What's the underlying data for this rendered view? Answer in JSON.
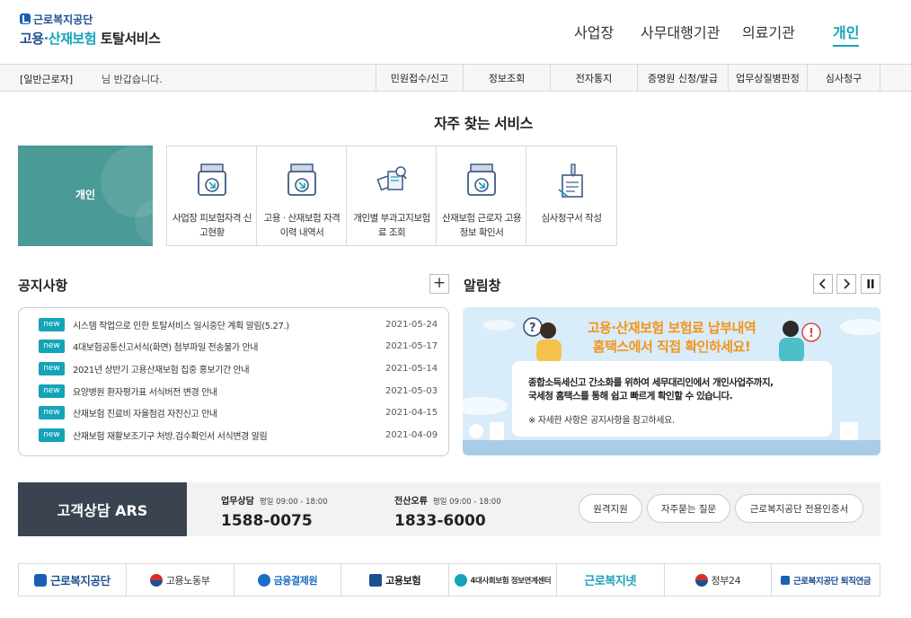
{
  "header": {
    "logo_top": "근로복지공단",
    "logo_main_a": "고용",
    "logo_main_b": "·산재보험",
    "logo_main_c": " 토탈서비스",
    "gnb": [
      "사업장",
      "사무대행기관",
      "의료기관",
      "개인"
    ]
  },
  "subbar": {
    "user": "[일반근로자]",
    "welcome": "님 반갑습니다.",
    "menu": [
      "민원접수/신고",
      "정보조회",
      "전자통지",
      "증명원 신청/발급",
      "업무상질병판정",
      "심사청구"
    ]
  },
  "favorites": {
    "title": "자주 찾는 서비스",
    "box_label": "개인",
    "items": [
      {
        "label": "사업장 피보험자격 신고현황",
        "icon": "document-tray-icon"
      },
      {
        "label": "고용 · 산재보험 자격 이력 내역서",
        "icon": "document-tray-icon"
      },
      {
        "label": "개인별 부과고지보험료 조회",
        "icon": "document-search-icon"
      },
      {
        "label": "산재보험 근로자 고용정보 확인서",
        "icon": "document-tray-icon"
      },
      {
        "label": "심사청구서 작성",
        "icon": "document-pen-icon"
      }
    ]
  },
  "notice": {
    "title": "공지사항",
    "plus": "+",
    "badge": "new",
    "rows": [
      {
        "text": "시스템 작업으로 인한 토탈서비스 일시중단 계획 알림(5.27.)",
        "date": "2021-05-24"
      },
      {
        "text": "4대보험공통신고서식(화면) 첨부파일 전송불가 안내",
        "date": "2021-05-17"
      },
      {
        "text": "2021년 상반기 고용산재보험 집중 홍보기간 안내",
        "date": "2021-05-14"
      },
      {
        "text": "요양병원 환자평가표 서식버전 변경 안내",
        "date": "2021-05-03"
      },
      {
        "text": "산재보험 진료비 자율점검 자진신고 안내",
        "date": "2021-04-15"
      },
      {
        "text": "산재보험 재활보조기구 처방.검수확인서 서식변경 알림",
        "date": "2021-04-09"
      }
    ]
  },
  "alarm": {
    "title": "알림창",
    "headline1": "고용·산재보험 보험료 납부내역",
    "headline2": "홈택스에서 직접 확인하세요!",
    "body1": "종합소득세신고 간소화를 위하여 세무대리인에서 개인사업주까지,",
    "body2": "국세청 홈택스를 통해 쉽고 빠르게 확인할 수 있습니다.",
    "note": "※ 자세한 사항은 공지사항을 참고하세요."
  },
  "customer": {
    "title": "고객상담 ARS",
    "blocks": [
      {
        "label": "업무상담",
        "hours": "평일 09:00 - 18:00",
        "number": "1588-0075"
      },
      {
        "label": "전산오류",
        "hours": "평일 09:00 - 18:00",
        "number": "1833-6000"
      }
    ],
    "buttons": [
      "원격지원",
      "자주묻는 질문",
      "근로복지공단 전용인증서"
    ]
  },
  "related": [
    "근로복지공단",
    "고용노동부",
    "금융결제원",
    "고용보험",
    "4대사회보험 정보연계센터",
    "근로복지넷",
    "정부24",
    "근로복지공단 퇴직연금"
  ],
  "colors": {
    "accent": "#14a3b8",
    "brand": "#1d4f91",
    "orange": "#f39418",
    "fav_box": "#4a9a96",
    "cs_dark": "#3c4350"
  }
}
